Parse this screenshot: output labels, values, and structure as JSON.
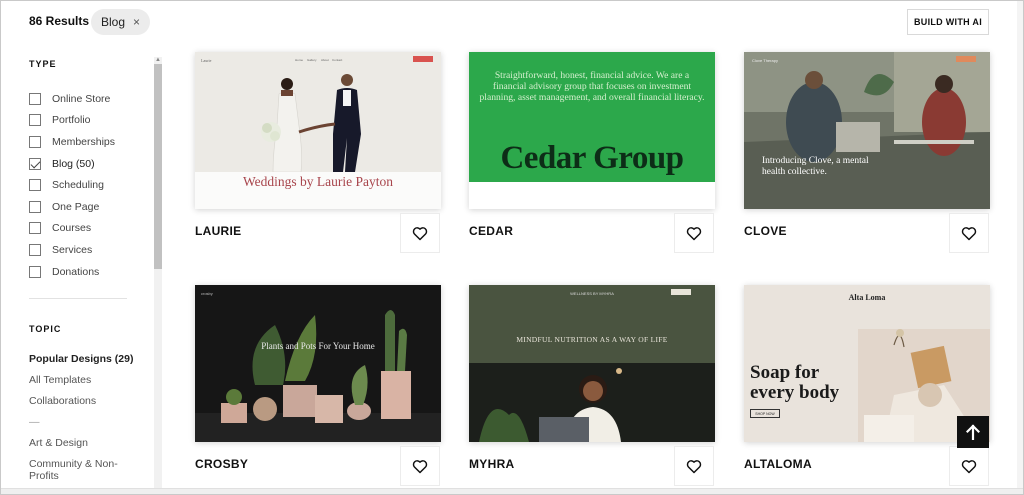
{
  "header": {
    "results_label": "86 Results",
    "active_filter": "Blog",
    "clear_symbol": "×",
    "build_ai_label": "BUILD WITH AI"
  },
  "sidebar": {
    "type_title": "TYPE",
    "type_items": [
      {
        "label": "Online Store",
        "checked": false
      },
      {
        "label": "Portfolio",
        "checked": false
      },
      {
        "label": "Memberships",
        "checked": false
      },
      {
        "label": "Blog (50)",
        "checked": true
      },
      {
        "label": "Scheduling",
        "checked": false
      },
      {
        "label": "One Page",
        "checked": false
      },
      {
        "label": "Courses",
        "checked": false
      },
      {
        "label": "Services",
        "checked": false
      },
      {
        "label": "Donations",
        "checked": false
      }
    ],
    "topic_title": "TOPIC",
    "topic_items": [
      {
        "label": "Popular Designs (29)",
        "strong": true
      },
      {
        "label": "All Templates",
        "strong": false
      },
      {
        "label": "Collaborations",
        "strong": false
      },
      {
        "label": "—",
        "strong": false
      },
      {
        "label": "Art & Design",
        "strong": false
      },
      {
        "label": "Community & Non-Profits",
        "strong": false
      }
    ]
  },
  "templates": [
    {
      "name": "LAURIE",
      "preview_title": "Weddings by Laurie Payton",
      "preview_logo": "Laurie",
      "nav": [
        "Home",
        "Gallery",
        "About",
        "Contact"
      ]
    },
    {
      "name": "CEDAR",
      "preview_tagline": "Straightforward, honest, financial advice. We are a financial advisory group that focuses on investment planning, asset management, and overall financial literacy.",
      "preview_logo": "Cedar Group"
    },
    {
      "name": "CLOVE",
      "preview_title": "Introducing Clove, a mental health collective.",
      "preview_logo": "Clove Therapy"
    },
    {
      "name": "CROSBY",
      "preview_title": "Plants and Pots For Your Home",
      "preview_logo": "crosby"
    },
    {
      "name": "MYHRA",
      "preview_title": "MINDFUL NUTRITION AS A WAY OF LIFE",
      "preview_logo": "WELLNESS BY MYHRA"
    },
    {
      "name": "ALTALOMA",
      "preview_title": "Soap for every body",
      "preview_logo": "Alta Loma",
      "preview_button": "SHOP NOW"
    }
  ],
  "icons": {
    "favorite": "heart-outline-icon",
    "back_to_top": "arrow-up-icon"
  },
  "colors": {
    "cedar_green": "#2ca84b",
    "laurie_title": "#a8454c",
    "myhra_olive": "#4a5440"
  }
}
